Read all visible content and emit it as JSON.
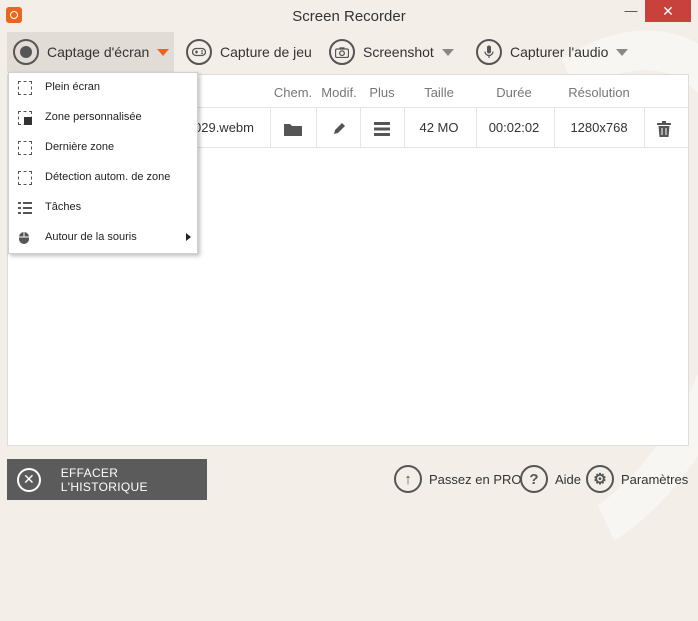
{
  "window": {
    "title": "Screen Recorder",
    "minimize": "—",
    "close": "✕"
  },
  "toolbar": {
    "screen_capture": "Captage d'écran",
    "game_capture": "Capture de jeu",
    "screenshot": "Screenshot",
    "audio": "Capturer l'audio"
  },
  "table": {
    "headers": {
      "path": "Chem.",
      "edit": "Modif.",
      "more": "Plus",
      "size": "Taille",
      "duration": "Durée",
      "resolution": "Résolution"
    },
    "row": {
      "filename": "029.webm",
      "size": "42 MO",
      "duration": "00:02:02",
      "resolution": "1280x768"
    }
  },
  "menu": {
    "items": [
      {
        "label": "Plein écran",
        "icon": "fullscreen-icon"
      },
      {
        "label": "Zone personnalisée",
        "icon": "custom-area-icon"
      },
      {
        "label": "Dernière zone",
        "icon": "last-area-icon"
      },
      {
        "label": "Détection autom. de zone",
        "icon": "auto-detect-icon"
      },
      {
        "label": "Tâches",
        "icon": "tasks-icon"
      },
      {
        "label": "Autour de la souris",
        "icon": "mouse-icon"
      }
    ]
  },
  "footer": {
    "clear_history": "EFFACER L'HISTORIQUE",
    "pro": "Passez en PRO",
    "help": "Aide",
    "settings": "Paramètres"
  },
  "colors": {
    "accent": "#e8661f",
    "close": "#c8413a",
    "clear_button": "#5b5b5b",
    "background": "#f3efe8"
  }
}
